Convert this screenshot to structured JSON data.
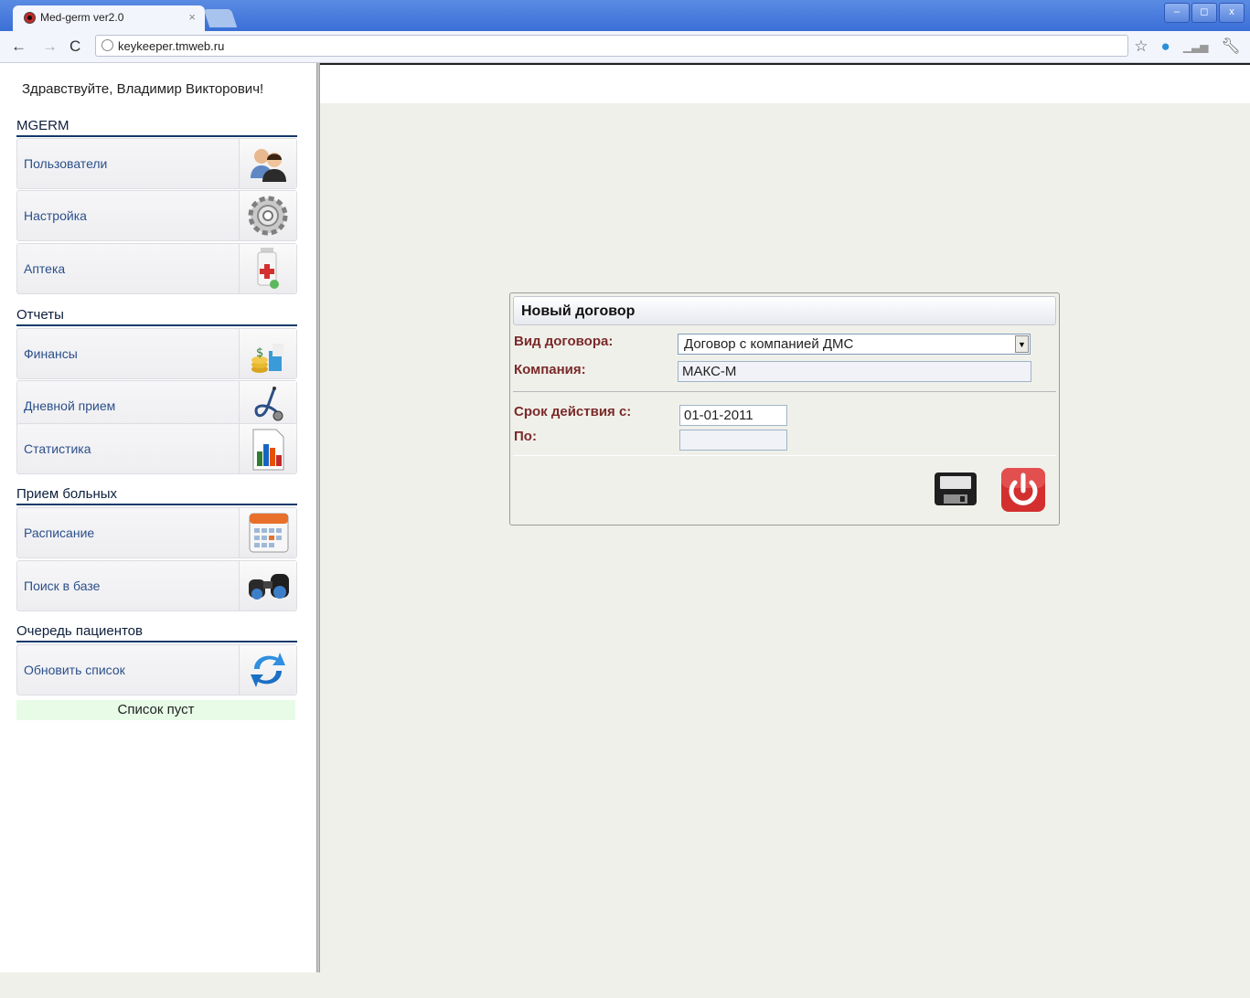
{
  "browser": {
    "tab_title": "Med-germ ver2.0",
    "tab_close": "×",
    "url": "keykeeper.tmweb.ru",
    "window_buttons": [
      "–",
      "◻",
      "x"
    ]
  },
  "sidebar": {
    "greeting": "Здравствуйте, Владимир Викторович!",
    "sections": [
      {
        "title": "MGERM",
        "items": [
          {
            "label": "Пользователи",
            "icon": "users-icon"
          },
          {
            "label": "Настройка",
            "icon": "gear-icon"
          },
          {
            "label": "Аптека",
            "icon": "pharmacy-icon"
          }
        ]
      },
      {
        "title": "Отчеты",
        "items": [
          {
            "label": "Финансы",
            "icon": "finance-icon"
          },
          {
            "label": "Дневной прием",
            "icon": "stethoscope-icon"
          },
          {
            "label": "Статистика",
            "icon": "chart-icon"
          }
        ]
      },
      {
        "title": "Прием больных",
        "items": [
          {
            "label": "Расписание",
            "icon": "calendar-icon"
          },
          {
            "label": "Поиск в базе",
            "icon": "binoculars-icon"
          }
        ]
      },
      {
        "title": "Очередь пациентов",
        "items": [
          {
            "label": "Обновить список",
            "icon": "refresh-icon"
          }
        ]
      }
    ],
    "queue_empty": "Список пуст"
  },
  "dialog": {
    "title": "Новый договор",
    "contract_type_label": "Вид договора:",
    "contract_type_value": "Договор с компанией ДМС",
    "company_label": "Компания:",
    "company_value": "МАКС-М",
    "valid_from_label": "Срок действия с:",
    "valid_from_value": "01-01-2011",
    "valid_to_label": "По:",
    "valid_to_value": ""
  },
  "colors": {
    "accent_blue": "#2b4f8a",
    "section_line": "#123a6a",
    "field_label": "#7a2a2a",
    "power_red": "#d32f2f",
    "empty_list_bg": "#e7fbe7"
  }
}
